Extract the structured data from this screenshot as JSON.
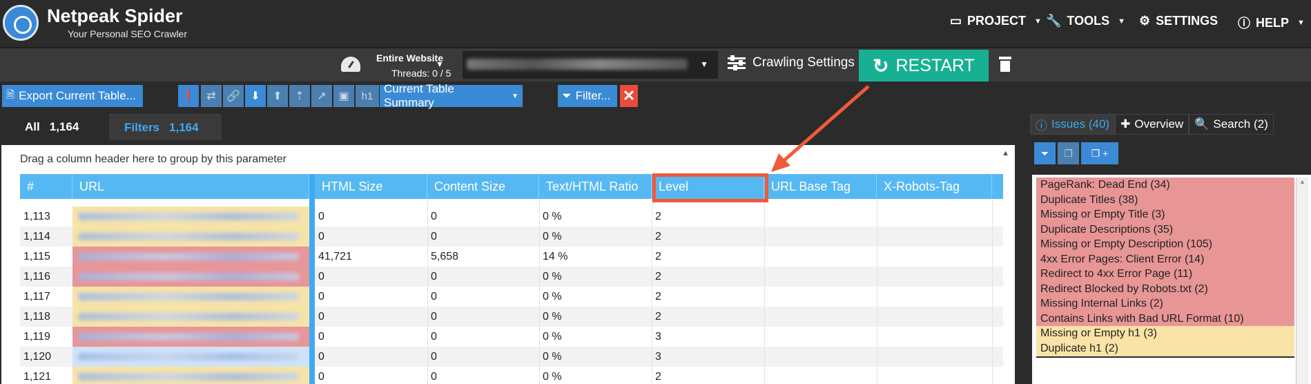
{
  "app": {
    "title": "Netpeak Spider",
    "subtitle": "Your Personal SEO Crawler"
  },
  "menu": {
    "project": "PROJECT",
    "tools": "TOOLS",
    "settings": "SETTINGS",
    "help": "HELP"
  },
  "crawl": {
    "scope": "Entire Website",
    "threads": "Threads: 0 / 5",
    "crawling_settings": "Crawling Settings",
    "restart": "RESTART"
  },
  "toolbar": {
    "export": "Export Current Table...",
    "h1": "h1",
    "summary": "Current Table Summary",
    "filter": "Filter..."
  },
  "tabs": {
    "all_label": "All",
    "all_count": "1,164",
    "filters_label": "Filters",
    "filters_count": "1,164"
  },
  "table": {
    "group_hint": "Drag a column header here to group by this parameter",
    "columns": [
      "#",
      "URL",
      "HTML Size",
      "Content Size",
      "Text/HTML Ratio",
      "Level",
      "URL Base Tag",
      "X-Robots-Tag"
    ],
    "rows": [
      {
        "num": "1,113",
        "html_size": "0",
        "content_size": "0",
        "ratio": "0 %",
        "level": "2",
        "url_color": "#f6e3a8"
      },
      {
        "num": "1,114",
        "html_size": "0",
        "content_size": "0",
        "ratio": "0 %",
        "level": "2",
        "url_color": "#f6e3a8"
      },
      {
        "num": "1,115",
        "html_size": "41,721",
        "content_size": "5,658",
        "ratio": "14 %",
        "level": "2",
        "url_color": "#e7969a"
      },
      {
        "num": "1,116",
        "html_size": "0",
        "content_size": "0",
        "ratio": "0 %",
        "level": "2",
        "url_color": "#e7969a"
      },
      {
        "num": "1,117",
        "html_size": "0",
        "content_size": "0",
        "ratio": "0 %",
        "level": "2",
        "url_color": "#f6e3a8"
      },
      {
        "num": "1,118",
        "html_size": "0",
        "content_size": "0",
        "ratio": "0 %",
        "level": "2",
        "url_color": "#f6e3a8"
      },
      {
        "num": "1,119",
        "html_size": "0",
        "content_size": "0",
        "ratio": "0 %",
        "level": "3",
        "url_color": "#e7969a"
      },
      {
        "num": "1,120",
        "html_size": "0",
        "content_size": "0",
        "ratio": "0 %",
        "level": "3",
        "url_color": "#cfe3f7"
      },
      {
        "num": "1,121",
        "html_size": "0",
        "content_size": "0",
        "ratio": "0 %",
        "level": "2",
        "url_color": "#f6e3a8"
      }
    ]
  },
  "sidebar": {
    "tabs": {
      "issues": "Issues (40)",
      "overview": "Overview",
      "search": "Search (2)"
    },
    "issues": [
      {
        "label": "PageRank: Dead End (34)",
        "severity": "red"
      },
      {
        "label": "Duplicate Titles (38)",
        "severity": "red"
      },
      {
        "label": "Missing or Empty Title (3)",
        "severity": "red"
      },
      {
        "label": "Duplicate Descriptions (35)",
        "severity": "red"
      },
      {
        "label": "Missing or Empty Description (105)",
        "severity": "red"
      },
      {
        "label": "4xx Error Pages: Client Error (14)",
        "severity": "red"
      },
      {
        "label": "Redirect to 4xx Error Page (11)",
        "severity": "red"
      },
      {
        "label": "Redirect Blocked by Robots.txt (2)",
        "severity": "red"
      },
      {
        "label": "Missing Internal Links (2)",
        "severity": "red"
      },
      {
        "label": "Contains Links with Bad URL Format (10)",
        "severity": "red"
      },
      {
        "label": "Missing or Empty h1 (3)",
        "severity": "yellow"
      },
      {
        "label": "Duplicate h1 (2)",
        "severity": "yellow"
      }
    ]
  },
  "colors": {
    "accent": "#3fa9f5",
    "header_blue": "#55b8f2",
    "restart": "#18b093",
    "highlight": "#f05a3a",
    "error": "#e89595",
    "warning": "#f9e3a6"
  }
}
